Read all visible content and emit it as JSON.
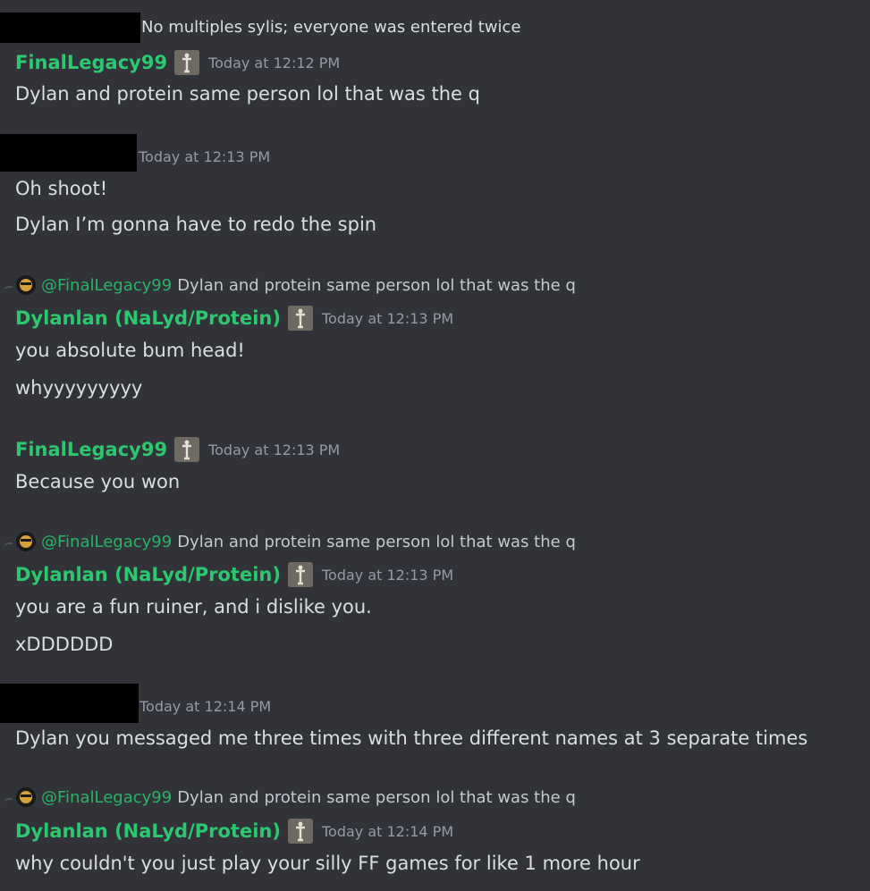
{
  "messages": {
    "m0": {
      "text": "No multiples sylis; everyone was entered twice"
    },
    "m1": {
      "author": "FinalLegacy99",
      "time": "Today at 12:12 PM",
      "lines": [
        "Dylan and protein same person lol that was the q"
      ]
    },
    "m2": {
      "time": "Today at 12:13 PM",
      "lines": [
        "Oh shoot!",
        "Dylan I’m gonna have to redo the spin"
      ]
    },
    "m3": {
      "reply_mention": "@FinalLegacy99",
      "reply_text": "Dylan and protein same person lol that was the q",
      "author": "Dylanlan (NaLyd/Protein)",
      "time": "Today at 12:13 PM",
      "lines": [
        "you absolute bum head!",
        "whyyyyyyyyy"
      ]
    },
    "m4": {
      "author": "FinalLegacy99",
      "time": "Today at 12:13 PM",
      "lines": [
        "Because you won"
      ]
    },
    "m5": {
      "reply_mention": "@FinalLegacy99",
      "reply_text": "Dylan and protein same person lol that was the q",
      "author": "Dylanlan (NaLyd/Protein)",
      "time": "Today at 12:13 PM",
      "lines": [
        "you are a fun ruiner, and i dislike you.",
        "xDDDDDD"
      ]
    },
    "m6": {
      "time": "Today at 12:14 PM",
      "lines": [
        "Dylan you messaged me three times with three different names at 3 separate times"
      ]
    },
    "m7": {
      "reply_mention": "@FinalLegacy99",
      "reply_text": "Dylan and protein same person lol that was the q",
      "author": "Dylanlan (NaLyd/Protein)",
      "time": "Today at 12:14 PM",
      "lines": [
        "why couldn't you just play your silly FF games for like 1 more hour"
      ]
    }
  },
  "colors": {
    "background": "#313338",
    "username": "#2dc770",
    "timestamp": "#949ba4",
    "text": "#dbdee1",
    "redaction": "#000000"
  },
  "icons": {
    "badge": "role-badge-icon",
    "reply_avatar": "avatar-icon"
  }
}
